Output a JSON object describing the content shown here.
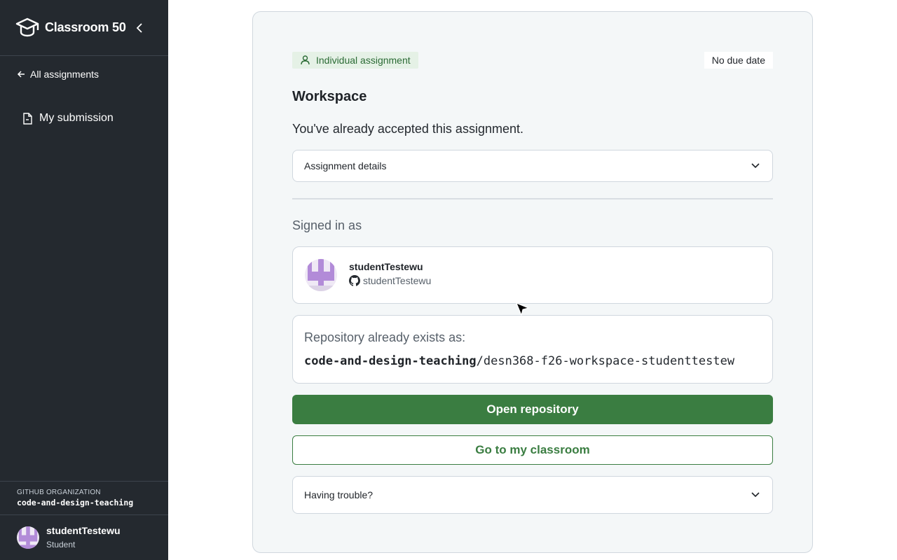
{
  "sidebar": {
    "brand": "Classroom 50",
    "back_link": "All assignments",
    "nav": [
      {
        "label": "My submission"
      }
    ],
    "org_label": "GITHUB ORGANIZATION",
    "org_name": "code-and-design-teaching",
    "user": {
      "name": "studentTestewu",
      "role": "Student"
    }
  },
  "assignment": {
    "type_badge": "Individual assignment",
    "due": "No due date",
    "title": "Workspace",
    "status": "You've already accepted this assignment.",
    "details_label": "Assignment details",
    "signed_in_label": "Signed in as",
    "user": {
      "name": "studentTestewu",
      "github": "studentTestewu"
    },
    "repo_label": "Repository already exists as:",
    "repo_org": "code-and-design-teaching",
    "repo_name": "/desn368-f26-workspace-studenttestew",
    "open_repo": "Open repository",
    "go_classroom": "Go to my classroom",
    "trouble_label": "Having trouble?"
  },
  "colors": {
    "sidebar_bg": "#24292f",
    "accent_green": "#3a7d41",
    "badge_bg": "#e5f1e6",
    "card_bg": "#f4f7f8"
  }
}
